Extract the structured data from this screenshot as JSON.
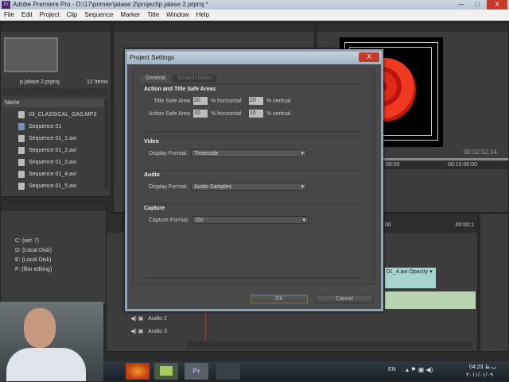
{
  "window": {
    "title": "Adobe Premiere Pro - D:\\17\\primier\\jalase 2\\project\\p jalase 2.prproj *",
    "app_icon": "Pr",
    "minimize": "—",
    "maximize": "□",
    "close": "X"
  },
  "menu": [
    "File",
    "Edit",
    "Project",
    "Clip",
    "Sequence",
    "Marker",
    "Title",
    "Window",
    "Help"
  ],
  "project": {
    "name": "p jalase 2.prproj",
    "count": "12 Items",
    "column": "Name",
    "items": [
      "03_CLASSICAL_GAS.MP3",
      "Sequence 01",
      "Sequence 01_1.avi",
      "Sequence 01_2.avi",
      "Sequence 01_3.avi",
      "Sequence 01_4.avi",
      "Sequence 01_5.avi"
    ]
  },
  "media_browser": {
    "drives": [
      "C: (win 7)",
      "D: (Local Disk)",
      "E: (Local Disk)",
      "F: (film editing)"
    ]
  },
  "program": {
    "timecode": "00:02:52:14",
    "ruler_start": ":00:00",
    "ruler_mid": "00:10:00:00"
  },
  "timeline": {
    "ruler_start": "00",
    "ruler_end": "00:00:1",
    "clip": "01_4.avi",
    "clip_effect": "Opacity ▾",
    "tracks": [
      "Audio 2",
      "Audio 3"
    ]
  },
  "dialog": {
    "title": "Project Settings",
    "close": "X",
    "tabs": [
      "General",
      "Scratch Disks"
    ],
    "safe": {
      "title": "Action and Title Safe Areas",
      "title_label": "Title Safe Area",
      "title_h": "20",
      "title_v": "20",
      "action_label": "Action Safe Area",
      "action_h": "10",
      "action_v": "10",
      "horizontal": "% horizontal",
      "vertical": "% vertical"
    },
    "video": {
      "title": "Video",
      "label": "Display Format:",
      "value": "Timecode"
    },
    "audio": {
      "title": "Audio",
      "label": "Display Format:",
      "value": "Audio Samples"
    },
    "capture": {
      "title": "Capture",
      "label": "Capture Format:",
      "value": "DV"
    },
    "ok": "OK",
    "cancel": "Cancel"
  },
  "taskbar": {
    "lang": "EN",
    "time": "04:23 ب.ظ",
    "date": "۲۰۱۱/۰۱/۰۹",
    "premiere": "Pr"
  }
}
